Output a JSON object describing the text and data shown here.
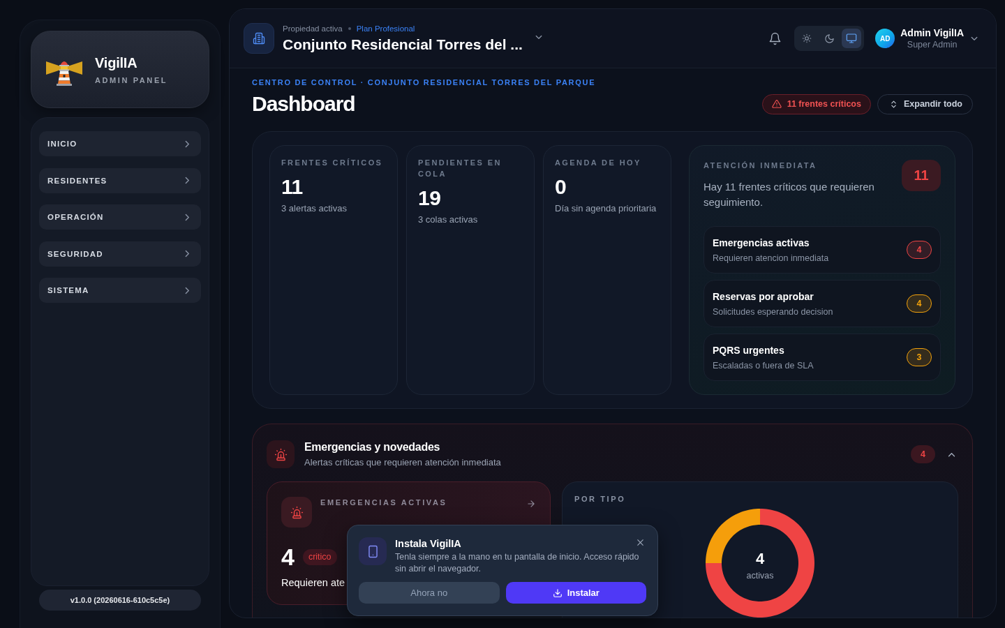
{
  "sidebar": {
    "logo": {
      "name": "VigilIA",
      "subtitle": "ADMIN PANEL"
    },
    "nav_items": [
      {
        "label": "INICIO"
      },
      {
        "label": "RESIDENTES"
      },
      {
        "label": "OPERACIÓN"
      },
      {
        "label": "SEGURIDAD"
      },
      {
        "label": "SISTEMA"
      }
    ],
    "version": "v1.0.0 (20260616-610c5c5e)"
  },
  "header": {
    "context_label": "Propiedad activa",
    "plan": "Plan Profesional",
    "property_name": "Conjunto Residencial Torres del ...",
    "theme_options": [
      {
        "selected": false
      },
      {
        "selected": false
      },
      {
        "selected": true
      }
    ],
    "user": {
      "initials": "AD",
      "name": "Admin VigilIA",
      "role": "Super Admin"
    }
  },
  "page": {
    "breadcrumb": "CENTRO DE CONTROL · CONJUNTO RESIDENCIAL TORRES DEL PARQUE",
    "title": "Dashboard",
    "actions": [
      {
        "label": "11 frentes críticos",
        "kind": "alert"
      },
      {
        "label": "Expandir todo",
        "kind": "expand"
      }
    ]
  },
  "stats": [
    {
      "label": "FRENTES CRÍTICOS",
      "value": "11",
      "detail": "3 alertas activas"
    },
    {
      "label": "PENDIENTES EN COLA",
      "value": "19",
      "detail": "3 colas activas"
    },
    {
      "label": "AGENDA DE HOY",
      "value": "0",
      "detail": "Día sin agenda prioritaria"
    }
  ],
  "attention": {
    "label": "ATENCIÓN INMEDIATA",
    "message": "Hay 11 frentes críticos que requieren seguimiento.",
    "count": "11",
    "items": [
      {
        "title": "Emergencias activas",
        "subtitle": "Requieren atencion inmediata",
        "count": "4",
        "color": "#ef4444"
      },
      {
        "title": "Reservas por aprobar",
        "subtitle": "Solicitudes esperando decision",
        "count": "4",
        "color": "#f5a30b"
      },
      {
        "title": "PQRS urgentes",
        "subtitle": "Escaladas o fuera de SLA",
        "count": "3",
        "color": "#f5a30b"
      }
    ]
  },
  "emergencies": {
    "title": "Emergencias y novedades",
    "subtitle": "Alertas críticas que requieren atención inmediata",
    "count": "4",
    "expanded": true,
    "active_card": {
      "label": "EMERGENCIAS ACTIVAS",
      "value": "4",
      "tag": "critico",
      "detail": "Requieren ate"
    },
    "by_type": {
      "label": "POR TIPO",
      "chart_data": {
        "type": "donut",
        "values": [
          75,
          25
        ],
        "colors": [
          "#ef4444",
          "#f59e0b"
        ]
      },
      "center_value": "4",
      "center_label": "activas"
    }
  },
  "install_prompt": {
    "title": "Instala VigilIA",
    "message": "Tenla siempre a la mano en tu pantalla de inicio. Acceso rápido sin abrir el navegador.",
    "buttons": [
      {
        "label": "Ahora no",
        "kind": "secondary"
      },
      {
        "label": "Instalar",
        "kind": "primary"
      }
    ]
  }
}
